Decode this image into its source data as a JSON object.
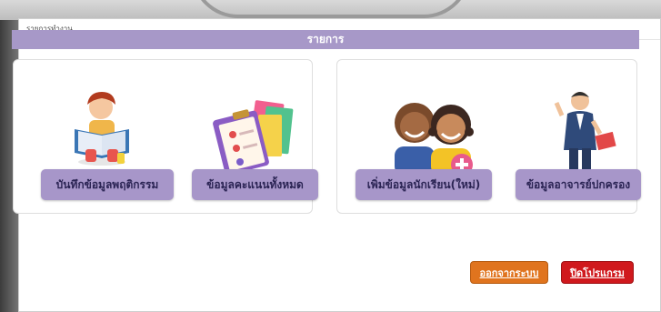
{
  "window": {
    "title": "รายการทำงาน"
  },
  "header": {
    "title": "รายการ"
  },
  "menu": {
    "record_behavior": "บันทึกข้อมูลพฤติกรรม",
    "all_scores": "ข้อมูลคะแนนทั้งหมด",
    "add_student": "เพิ่มข้อมูลนักเรียน(ใหม่)",
    "advisor_info": "ข้อมูลอาจารย์ปกครอง"
  },
  "actions": {
    "logout": "ออกจากระบบ",
    "close_program": "ปิดโปรแกรม"
  },
  "colors": {
    "header": "#a798c8",
    "menu_button": "#a796c9",
    "logout_button": "#e0741e",
    "close_button": "#d0191d"
  },
  "icons": {
    "record_behavior": "child-reading-book-icon",
    "all_scores": "clipboard-checklist-icon",
    "add_student": "students-add-icon",
    "advisor_info": "teacher-presenting-icon"
  }
}
